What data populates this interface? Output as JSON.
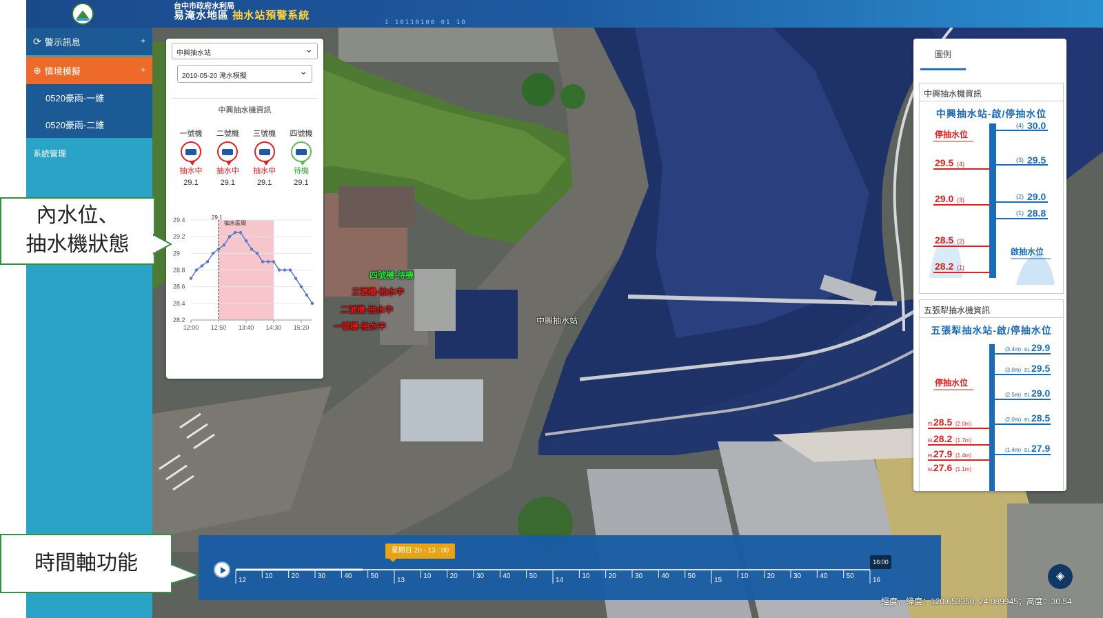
{
  "header": {
    "agency": "台中市政府水利局",
    "title_main": "易淹水地區",
    "title_highlight": "抽水站預警系統",
    "deco_text": "1 10110100 01 10"
  },
  "sidebar": {
    "alert_label": "警示訊息",
    "scenario_label": "情境模擬",
    "sub_items": [
      {
        "label": "0520豪雨-一維"
      },
      {
        "label": "0520豪雨-二維"
      }
    ],
    "system_label": "系統管理",
    "expand_glyph": "+"
  },
  "left_panel": {
    "station_select": "中興抽水站",
    "scenario_select": "2019-05-20 淹水模擬",
    "card_title": "中興抽水機資訊",
    "pumps": [
      {
        "name": "一號機",
        "status": "抽水中",
        "level": "29.1",
        "state": "run"
      },
      {
        "name": "二號機",
        "status": "抽水中",
        "level": "29.1",
        "state": "run"
      },
      {
        "name": "三號機",
        "status": "抽水中",
        "level": "29.1",
        "state": "run"
      },
      {
        "name": "四號機",
        "status": "待機",
        "level": "29.1",
        "state": "idle"
      }
    ]
  },
  "chart_data": {
    "type": "line",
    "title": "",
    "xlabel": "",
    "ylabel": "",
    "x": [
      "12:00",
      "12:10",
      "12:20",
      "12:30",
      "12:40",
      "12:50",
      "13:00",
      "13:10",
      "13:20",
      "13:30",
      "13:40",
      "13:50",
      "14:00",
      "14:10",
      "14:20",
      "14:30",
      "14:40",
      "14:50",
      "15:00",
      "15:10",
      "15:20",
      "15:30",
      "15:40"
    ],
    "x_ticks": [
      "12:00",
      "12:50",
      "13:40",
      "14:30",
      "15:20"
    ],
    "y_ticks": [
      "29.4",
      "29.2",
      "29",
      "28.8",
      "28.6",
      "28.4",
      "28.2"
    ],
    "ylim": [
      28.2,
      29.4
    ],
    "series": [
      {
        "values": [
          28.7,
          28.8,
          28.85,
          28.9,
          29.0,
          29.05,
          29.1,
          29.2,
          29.25,
          29.25,
          29.15,
          29.05,
          29.0,
          28.9,
          28.9,
          28.9,
          28.8,
          28.8,
          28.8,
          28.7,
          28.6,
          28.5,
          28.4
        ]
      }
    ],
    "highlight_range": [
      "12:50",
      "14:30"
    ],
    "highlight_label": "抽水區間",
    "marker_value": "29.1",
    "marker_x": "12:50",
    "colors": {
      "line": "#5577cc",
      "highlight": "#f7c6cc"
    }
  },
  "map_labels": {
    "pump4": "四號機-待機",
    "pump3": "三號機-抽水中",
    "pump2": "二號機-抽水中",
    "pump1": "一號機-抽水中",
    "station": "中興抽水站"
  },
  "callouts": {
    "inner_water_l1": "內水位、",
    "inner_water_l2": "抽水機狀態",
    "timeline": "時間軸功能"
  },
  "right_panel": {
    "tab_label": "圖例",
    "card1": {
      "header": "中興抽水機資訊",
      "subtitle": "中興抽水站-啟/停抽水位",
      "stop_label": "停抽水位",
      "start_label": "啟抽水位",
      "right_levels": [
        {
          "tag": "(4)",
          "value": "30.0"
        },
        {
          "tag": "(3)",
          "value": "29.5"
        },
        {
          "tag": "(2)",
          "value": "29.0"
        },
        {
          "tag": "(1)",
          "value": "28.8"
        }
      ],
      "left_levels": [
        {
          "tag": "(4)",
          "value": "29.5"
        },
        {
          "tag": "(3)",
          "value": "29.0"
        },
        {
          "tag": "(2)",
          "value": "28.5"
        },
        {
          "tag": "(1)",
          "value": "28.2"
        }
      ]
    },
    "card2": {
      "header": "五張犁抽水機資訊",
      "subtitle": "五張犁抽水站-啟/停抽水位",
      "stop_label": "停抽水位",
      "el": "EL",
      "right_levels": [
        {
          "tag": "(3.4m)",
          "value": "29.9"
        },
        {
          "tag": "(3.0m)",
          "value": "29.5"
        },
        {
          "tag": "(2.5m)",
          "value": "29.0"
        },
        {
          "tag": "(2.0m)",
          "value": "28.5"
        },
        {
          "tag": "(1.4m)",
          "value": "27.9"
        }
      ],
      "left_levels": [
        {
          "tag": "(2.0m)",
          "value": "28.5"
        },
        {
          "tag": "(1.7m)",
          "value": "28.2"
        },
        {
          "tag": "(1.4m)",
          "value": "27.9"
        },
        {
          "tag": "(1.1m)",
          "value": "27.6"
        }
      ]
    }
  },
  "timeline": {
    "current_label": "星期日 20 - 13 : 00",
    "end_label": "16:00",
    "ticks": [
      {
        "label": "12",
        "major": true
      },
      {
        "label": "10"
      },
      {
        "label": "20"
      },
      {
        "label": "30"
      },
      {
        "label": "40"
      },
      {
        "label": "50"
      },
      {
        "label": "13",
        "major": true
      },
      {
        "label": "10"
      },
      {
        "label": "20"
      },
      {
        "label": "30"
      },
      {
        "label": "40"
      },
      {
        "label": "50"
      },
      {
        "label": "14",
        "major": true
      },
      {
        "label": "10"
      },
      {
        "label": "20"
      },
      {
        "label": "30"
      },
      {
        "label": "40"
      },
      {
        "label": "50"
      },
      {
        "label": "15",
        "major": true
      },
      {
        "label": "10"
      },
      {
        "label": "20"
      },
      {
        "label": "30"
      },
      {
        "label": "40"
      },
      {
        "label": "50"
      },
      {
        "label": "16",
        "major": true
      }
    ],
    "progress": 0.2
  },
  "coords": "經度，緯度：120.653350, 24.089945；高度：30.54"
}
